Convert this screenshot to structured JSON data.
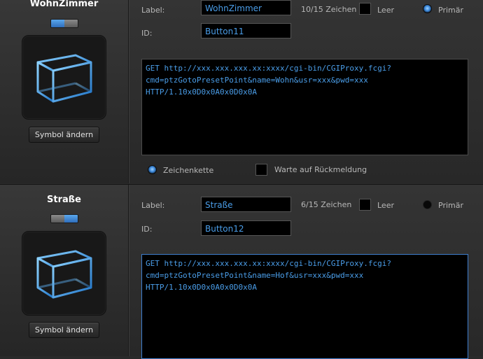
{
  "buttons": [
    {
      "title": "WohnZimmer",
      "symbol_button": "Symbol ändern",
      "label_caption": "Label:",
      "label_value": "WohnZimmer",
      "char_count": "10/15 Zeichen",
      "empty_label": "Leer",
      "primary_label": "Primär",
      "id_caption": "ID:",
      "id_value": "Button11",
      "command_line1": "GET http://xxx.xxx.xxx.xx:xxxx/cgi-bin/CGIProxy.fcgi?",
      "command_line2": "cmd=ptzGotoPresetPoint&name=Wohn&usr=xxx&pwd=xxx",
      "command_line3": "HTTP/1.10x0D0x0A0x0D0x0A",
      "string_label": "Zeichenkette",
      "wait_label": "Warte auf Rückmeldung",
      "toggle_state": "right",
      "primary_selected": true
    },
    {
      "title": "Straße",
      "symbol_button": "Symbol ändern",
      "label_caption": "Label:",
      "label_value": "Straße",
      "char_count": "6/15 Zeichen",
      "empty_label": "Leer",
      "primary_label": "Primär",
      "id_caption": "ID:",
      "id_value": "Button12",
      "command_line1": "GET http://xxx.xxx.xxx.xx:xxxx/cgi-bin/CGIProxy.fcgi?",
      "command_line2": "cmd=ptzGotoPresetPoint&name=Hof&usr=xxx&pwd=xxx",
      "command_line3": "HTTP/1.10x0D0x0A0x0D0x0A",
      "toggle_state": "left",
      "primary_selected": false
    }
  ],
  "colors": {
    "accent": "#4a9de8",
    "field_bg": "#000000",
    "panel_bg": "#2a2a2a"
  },
  "icons": {
    "symbol": "cube-wireframe-icon"
  }
}
